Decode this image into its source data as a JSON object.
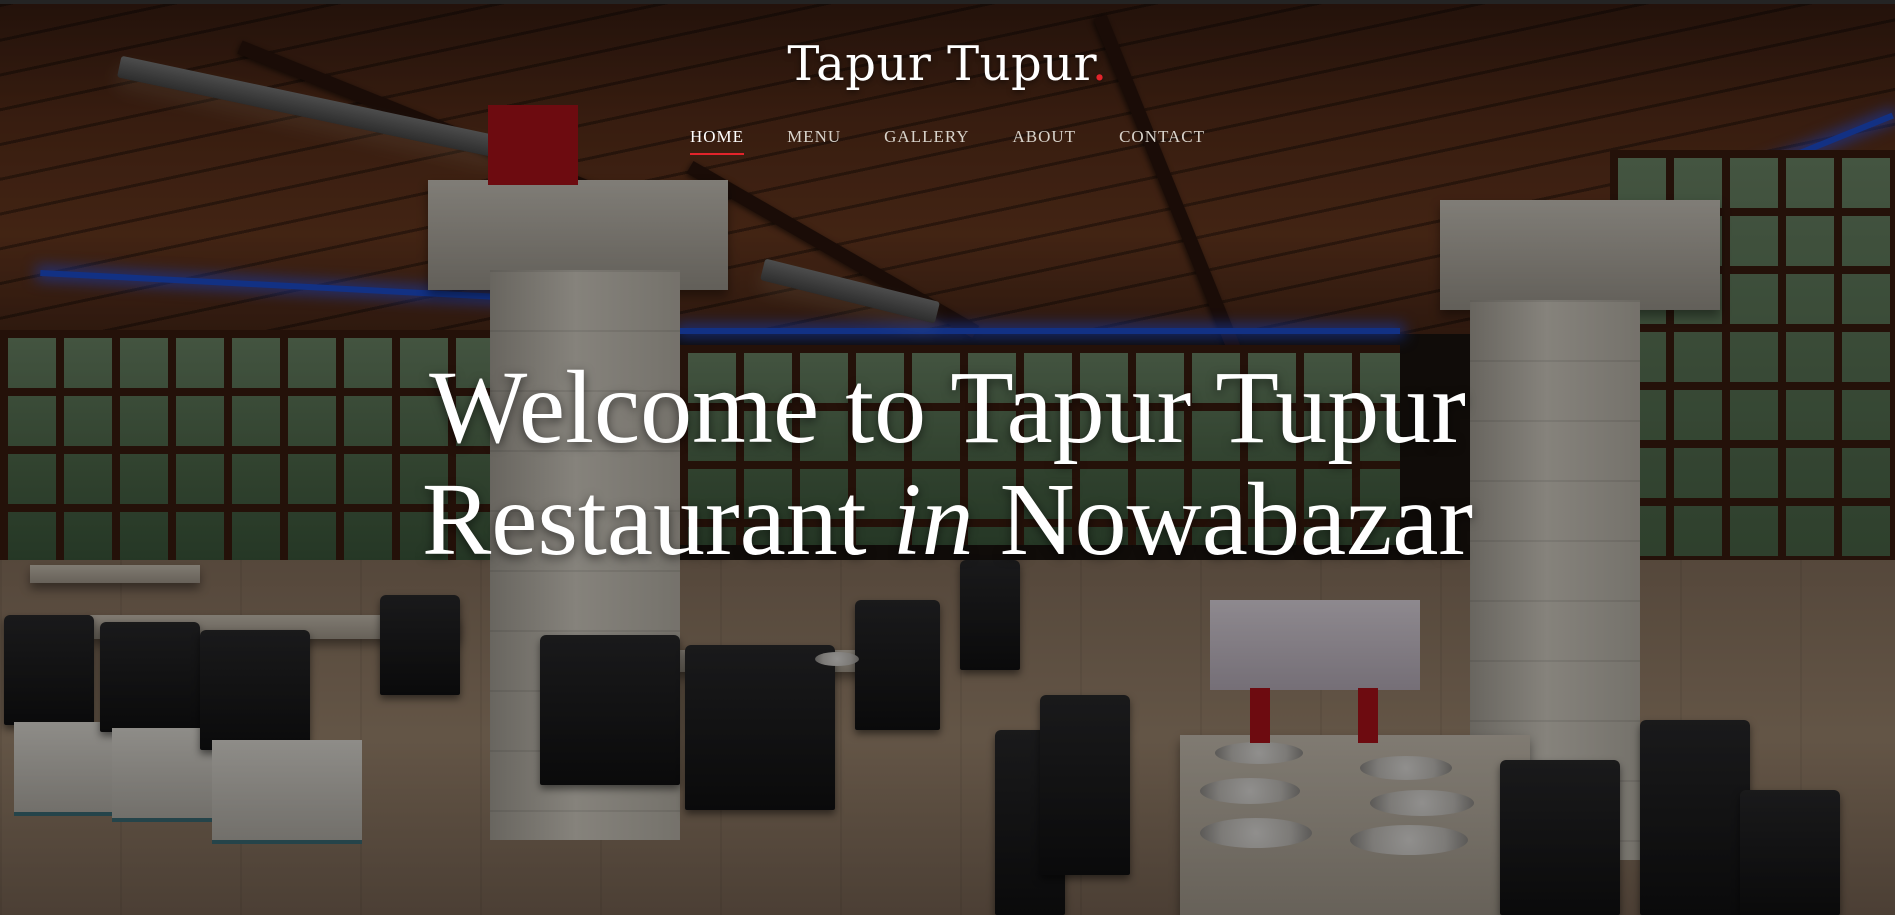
{
  "brand": {
    "name": "Tapur Tupur",
    "dot": ".",
    "dot_color": "#e3242b"
  },
  "nav": {
    "items": [
      {
        "label": "HOME",
        "active": true
      },
      {
        "label": "MENU",
        "active": false
      },
      {
        "label": "GALLERY",
        "active": false
      },
      {
        "label": "ABOUT",
        "active": false
      },
      {
        "label": "CONTACT",
        "active": false
      }
    ],
    "active_underline_color": "#e3242b"
  },
  "hero": {
    "line1": "Welcome to Tapur Tupur",
    "line2_start": "Restaurant",
    "line2_em": "in",
    "line2_end": "Nowabazar"
  },
  "background": {
    "image_subject": "restaurant dining hall interior",
    "accent_neon": "#1d4fd6"
  }
}
